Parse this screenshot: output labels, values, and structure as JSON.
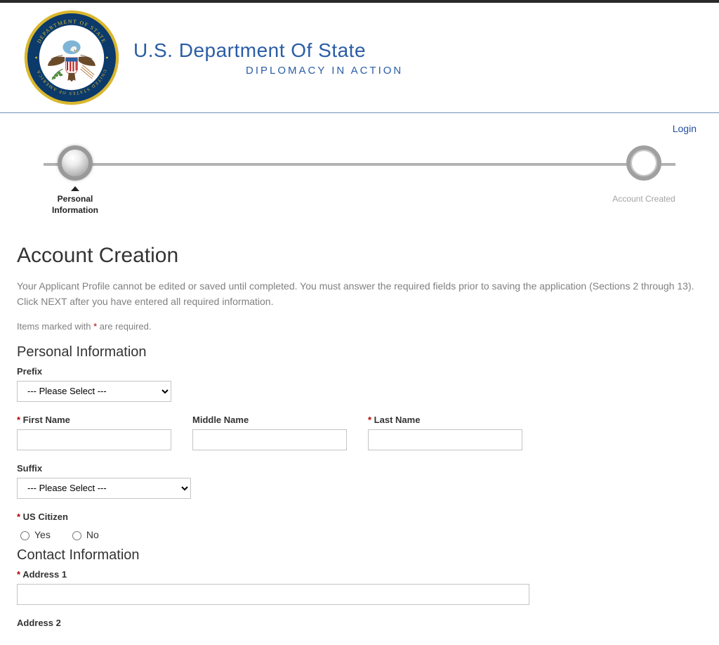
{
  "header": {
    "title": "U.S. Department Of State",
    "tagline": "DIPLOMACY IN ACTION"
  },
  "nav": {
    "login": "Login"
  },
  "progress": {
    "step1": "Personal Information",
    "step2": "Account Created"
  },
  "page": {
    "title": "Account Creation",
    "intro": "Your Applicant Profile cannot be edited or saved until completed. You must answer the required fields prior to saving the application (Sections 2 through 13). Click NEXT after you have entered all required information.",
    "required_note_prefix": "Items marked with ",
    "required_note_suffix": " are required."
  },
  "sections": {
    "personal": "Personal Information",
    "contact": "Contact Information"
  },
  "labels": {
    "prefix": "Prefix",
    "first_name": "First Name",
    "middle_name": "Middle Name",
    "last_name": "Last Name",
    "suffix": "Suffix",
    "us_citizen": "US Citizen",
    "yes": "Yes",
    "no": "No",
    "address1": "Address 1",
    "address2": "Address 2"
  },
  "options": {
    "please_select": "--- Please Select ---"
  }
}
